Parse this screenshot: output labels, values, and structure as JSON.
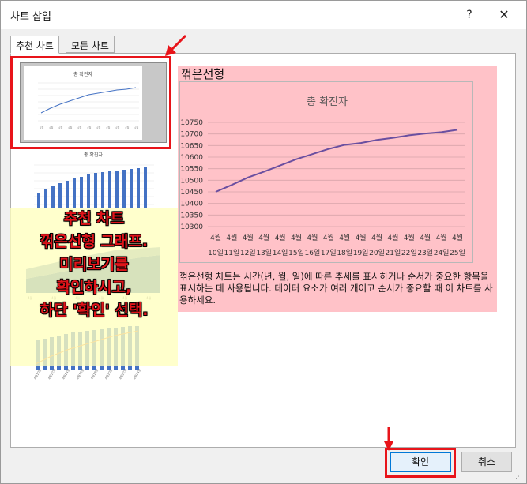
{
  "dialog": {
    "title": "차트 삽입",
    "help_glyph": "?",
    "close_glyph": "✕"
  },
  "tabs": [
    {
      "label": "추천 차트",
      "active": true
    },
    {
      "label": "모든 차트",
      "active": false
    }
  ],
  "thumbnails": {
    "thumb1_title": "총 확진자",
    "thumb2_title": "총 확진자"
  },
  "preview": {
    "chart_type_title": "꺾은선형",
    "description": "꺾은선형 차트는 시간(년, 월, 일)에 따른 추세를 표시하거나 순서가 중요한 항목을 표시하는 데 사용됩니다. 데이터 요소가 여러 개이고 순서가 중요할 때 이 차트를 사용하세요."
  },
  "annotation": {
    "lines": [
      "추천 차트",
      "꺾은선형 그래프.",
      "미리보기를",
      "확인하시고,",
      "하단 '확인' 선택."
    ],
    "highlight_color": "#e8141a"
  },
  "buttons": {
    "ok_label": "확인",
    "cancel_label": "취소"
  },
  "chart_data": {
    "type": "line",
    "title": "총 확진자",
    "categories_top": [
      "4월",
      "4월",
      "4월",
      "4월",
      "4월",
      "4월",
      "4월",
      "4월",
      "4월",
      "4월",
      "4월",
      "4월",
      "4월",
      "4월",
      "4월",
      "4월"
    ],
    "categories_bottom": [
      "10일",
      "11일",
      "12일",
      "13일",
      "14일",
      "15일",
      "16일",
      "17일",
      "18일",
      "19일",
      "20일",
      "21일",
      "22일",
      "23일",
      "24일",
      "25일"
    ],
    "series": [
      {
        "values": [
          10450,
          10480,
          10512,
          10537,
          10564,
          10591,
          10613,
          10635,
          10653,
          10661,
          10674,
          10683,
          10694,
          10702,
          10708,
          10718
        ]
      }
    ],
    "yticks": [
      10300,
      10350,
      10400,
      10450,
      10500,
      10550,
      10600,
      10650,
      10700,
      10750
    ],
    "ylim": [
      10300,
      10750
    ],
    "grid": true,
    "line_color": "#6a4fa0"
  }
}
